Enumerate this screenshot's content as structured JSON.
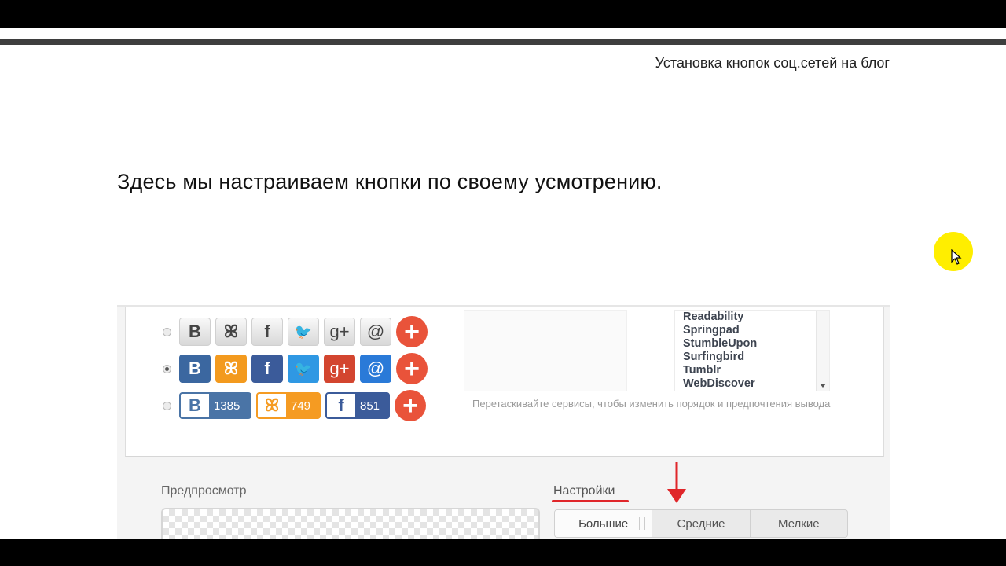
{
  "slide": {
    "title": "Установка кнопок соц.сетей на блог",
    "text": "Здесь мы настраиваем кнопки по своему усмотрению."
  },
  "styles": [
    {
      "selected": false,
      "buttons": [
        {
          "icon": "vk-icon",
          "glyph": "B"
        },
        {
          "icon": "odnoklassniki-icon",
          "glyph": "ꕤ"
        },
        {
          "icon": "facebook-icon",
          "glyph": "f"
        },
        {
          "icon": "twitter-icon",
          "glyph": "🐦"
        },
        {
          "icon": "google-plus-icon",
          "glyph": "g+"
        },
        {
          "icon": "mail-icon",
          "glyph": "@"
        }
      ]
    },
    {
      "selected": true,
      "buttons": [
        {
          "icon": "vk-icon",
          "glyph": "B"
        },
        {
          "icon": "odnoklassniki-icon",
          "glyph": "ꕤ"
        },
        {
          "icon": "facebook-icon",
          "glyph": "f"
        },
        {
          "icon": "twitter-icon",
          "glyph": "🐦"
        },
        {
          "icon": "google-plus-icon",
          "glyph": "g+"
        },
        {
          "icon": "mail-icon",
          "glyph": "@"
        }
      ]
    },
    {
      "selected": false,
      "counters": [
        {
          "icon": "vk-icon",
          "glyph": "B",
          "count": "1385"
        },
        {
          "icon": "odnoklassniki-icon",
          "glyph": "ꕤ",
          "count": "749"
        },
        {
          "icon": "facebook-icon",
          "glyph": "f",
          "count": "851"
        }
      ]
    }
  ],
  "plus_glyph": "+",
  "services": [
    "Readability",
    "Springpad",
    "StumbleUpon",
    "Surfingbird",
    "Tumblr",
    "WebDiscover"
  ],
  "hint": "Перетаскивайте сервисы, чтобы изменить порядок и предпочтения вывода",
  "preview_label": "Предпросмотр",
  "settings_label": "Настройки",
  "size_options": [
    {
      "label": "Большие",
      "active": true
    },
    {
      "label": "Средние",
      "active": false
    },
    {
      "label": "Мелкие",
      "active": false
    }
  ],
  "colors": {
    "vk": "#3b67a0",
    "odnoklassniki": "#f39a1e",
    "facebook": "#3b5b9a",
    "twitter": "#2f98e3",
    "google_plus": "#d3452f",
    "mail": "#2a7ad8",
    "plus": "#e9533a",
    "annotation_red": "#e0262a",
    "cursor_highlight": "#ffee00"
  }
}
